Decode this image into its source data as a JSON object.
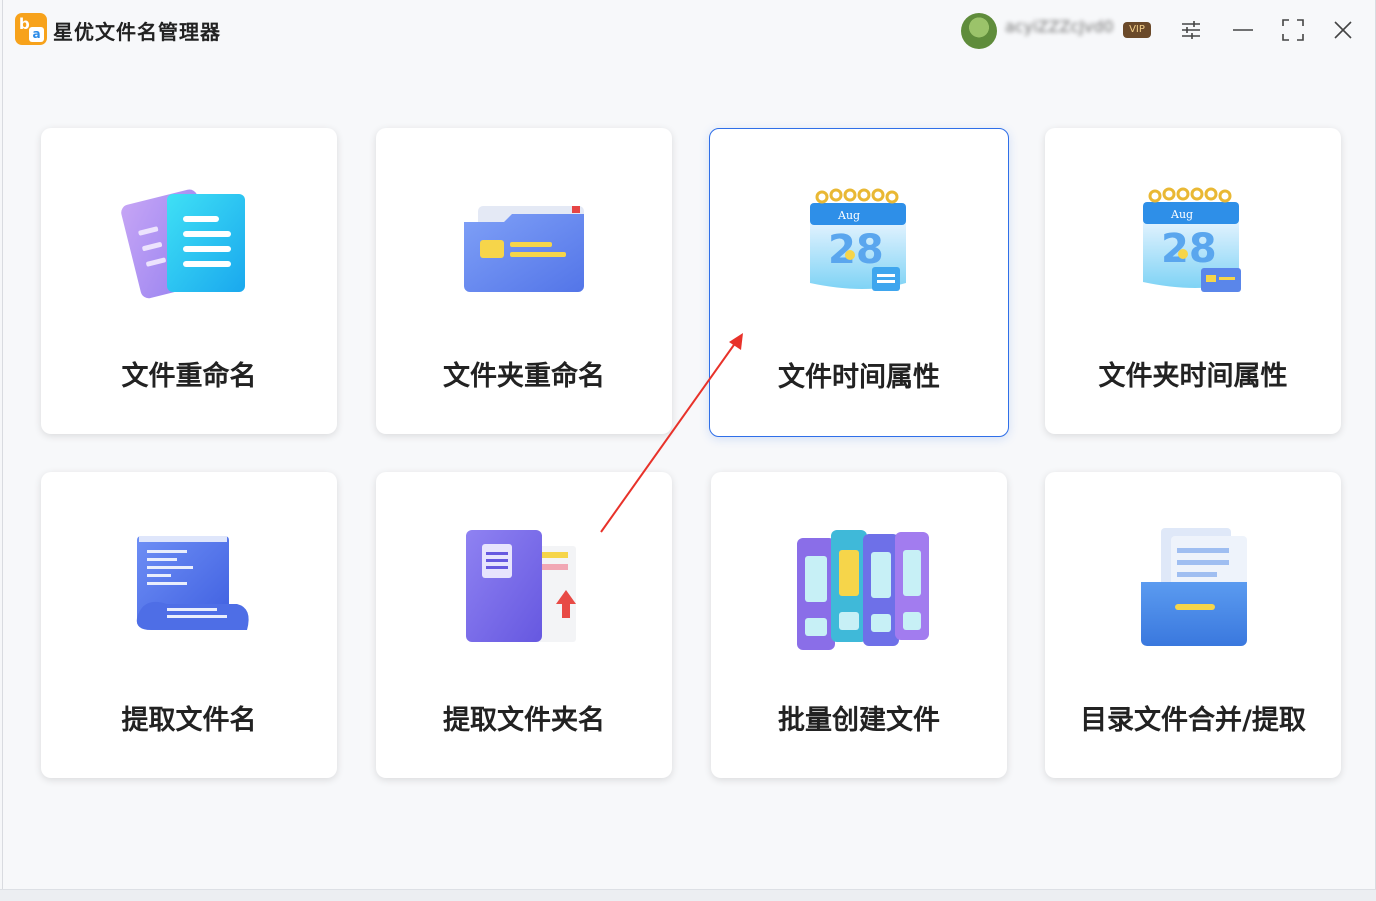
{
  "app": {
    "title": "星优文件名管理器",
    "logo_b": "b",
    "logo_a": "a"
  },
  "user": {
    "name": "acyiZZZcJvd0",
    "vip": "VIP"
  },
  "tiles": [
    {
      "label": "文件重命名",
      "icon": "file-document-icon"
    },
    {
      "label": "文件夹重命名",
      "icon": "folder-card-icon"
    },
    {
      "label": "文件时间属性",
      "icon": "calendar-file-icon",
      "calendar_month": "Aug",
      "calendar_day": "28"
    },
    {
      "label": "文件夹时间属性",
      "icon": "calendar-folder-icon",
      "calendar_month": "Aug",
      "calendar_day": "28"
    },
    {
      "label": "提取文件名",
      "icon": "scroll-list-icon"
    },
    {
      "label": "提取文件夹名",
      "icon": "folder-extract-icon"
    },
    {
      "label": "批量创建文件",
      "icon": "binders-icon"
    },
    {
      "label": "目录文件合并/提取",
      "icon": "drawer-folder-icon"
    }
  ],
  "colors": {
    "accent": "#2f6fe8",
    "arrow": "#e8322a",
    "logo": "#f7a21b"
  }
}
